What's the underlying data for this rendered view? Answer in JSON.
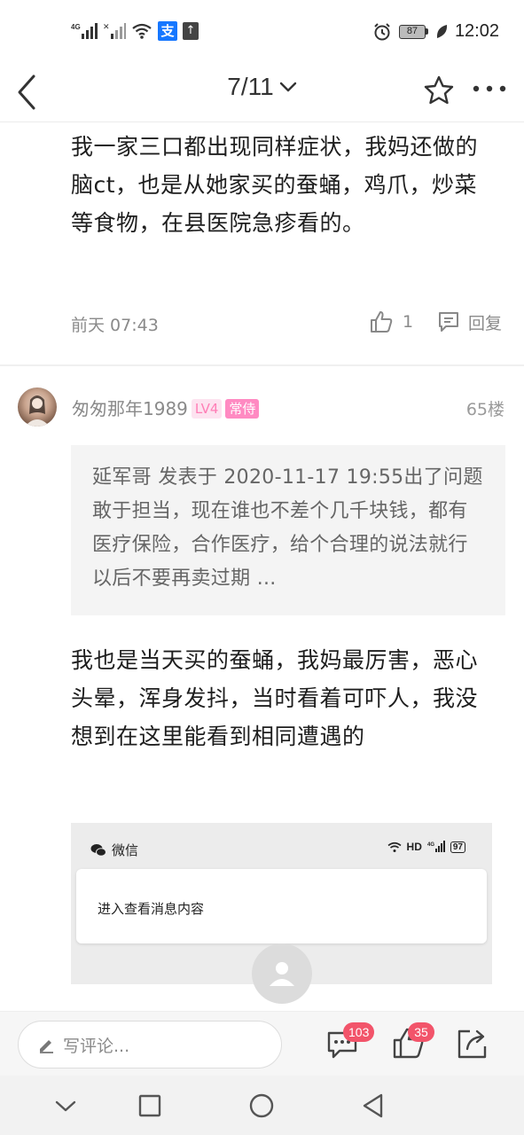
{
  "status_bar": {
    "network_1": "4G",
    "network_2": "4G",
    "battery": "87",
    "time": "12:02",
    "alipay_glyph": "支"
  },
  "nav": {
    "page_indicator": "7/11"
  },
  "post": {
    "text": "我一家三口都出现同样症状，我妈还做的脑ct，也是从她家买的蚕蛹，鸡爪，炒菜等食物，在县医院急疹看的。",
    "time": "前天 07:43",
    "like_count": "1",
    "reply_label": "回复"
  },
  "floor": {
    "username": "匆匆那年1989",
    "level_badge": "LV4",
    "regular_badge": "常侍",
    "floor_number": "65楼",
    "quote": "延军哥 发表于 2020-11-17 19:55出了问题敢于担当，现在谁也不差个几千块钱，都有医疗保险，合作医疗，给个合理的说法就行以后不要再卖过期 ...",
    "reply_text": "我也是当天买的蚕蛹，我妈最厉害，恶心头晕，浑身发抖，当时看着可吓人，我没想到在这里能看到相同遭遇的",
    "embedded_screenshot": {
      "app_name": "微信",
      "hd_label": "HD",
      "network": "4G",
      "battery": "97",
      "notification_text": "进入查看消息内容"
    }
  },
  "bottom_bar": {
    "comment_placeholder": "写评论...",
    "comment_count": "103",
    "like_count": "35"
  },
  "colors": {
    "badge_pink": "#ff8ac2",
    "count_red": "#f2546a",
    "alipay_blue": "#1677ff"
  }
}
